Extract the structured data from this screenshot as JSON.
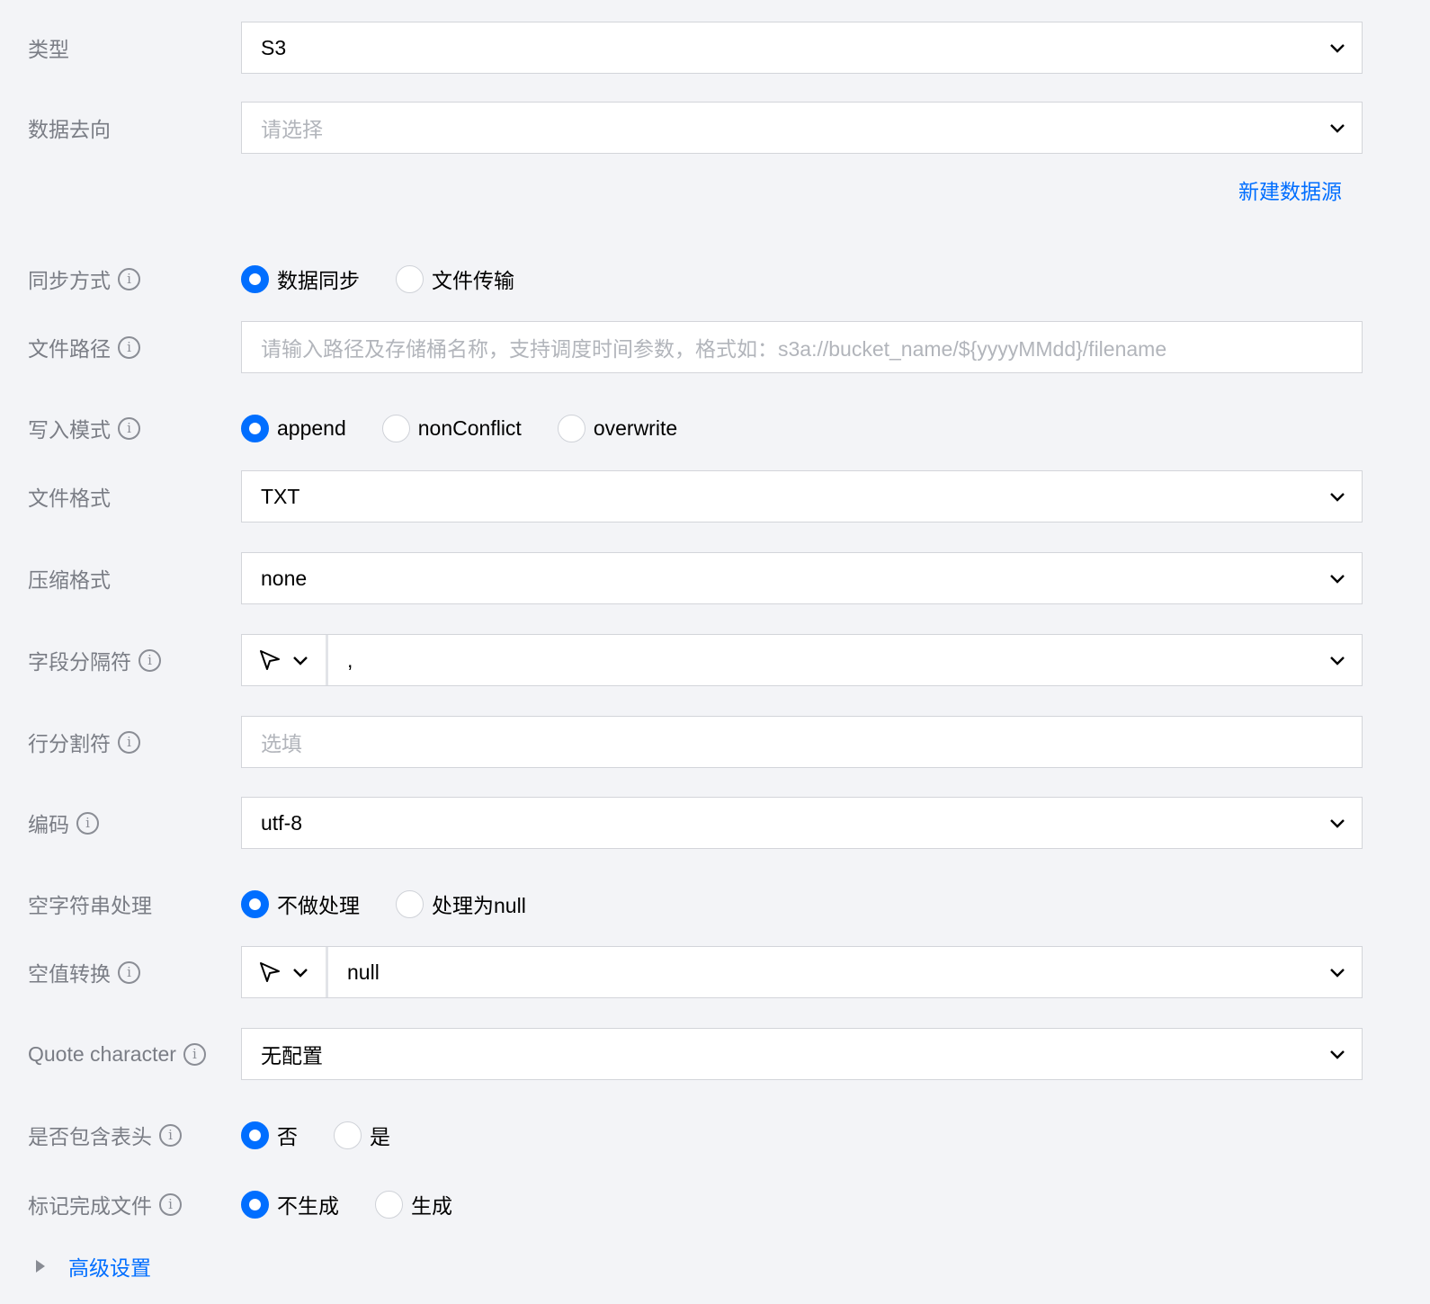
{
  "type": {
    "label": "类型",
    "value": "S3"
  },
  "destination": {
    "label": "数据去向",
    "placeholder": "请选择",
    "new_source_link": "新建数据源"
  },
  "sync_mode": {
    "label": "同步方式",
    "options": [
      "数据同步",
      "文件传输"
    ],
    "selected": 0
  },
  "file_path": {
    "label": "文件路径",
    "placeholder": "请输入路径及存储桶名称，支持调度时间参数，格式如：s3a://bucket_name/${yyyyMMdd}/filename"
  },
  "write_mode": {
    "label": "写入模式",
    "options": [
      "append",
      "nonConflict",
      "overwrite"
    ],
    "selected": 0
  },
  "file_format": {
    "label": "文件格式",
    "value": "TXT"
  },
  "compression": {
    "label": "压缩格式",
    "value": "none"
  },
  "field_delimiter": {
    "label": "字段分隔符",
    "value": ","
  },
  "line_delimiter": {
    "label": "行分割符",
    "placeholder": "选填"
  },
  "encoding": {
    "label": "编码",
    "value": "utf-8"
  },
  "empty_string": {
    "label": "空字符串处理",
    "options": [
      "不做处理",
      "处理为null"
    ],
    "selected": 0
  },
  "null_convert": {
    "label": "空值转换",
    "value": "null"
  },
  "quote_char": {
    "label": "Quote character",
    "value": "无配置"
  },
  "has_header": {
    "label": "是否包含表头",
    "options": [
      "否",
      "是"
    ],
    "selected": 0
  },
  "done_file": {
    "label": "标记完成文件",
    "options": [
      "不生成",
      "生成"
    ],
    "selected": 0
  },
  "advanced": {
    "label": "高级设置"
  },
  "colors": {
    "accent": "#006eff",
    "label": "#7a7d85",
    "border": "#d3d5da",
    "background": "#f3f4f7"
  },
  "icons": [
    "info-icon",
    "chevron-down-icon",
    "cursor-icon",
    "caret-right-icon"
  ]
}
